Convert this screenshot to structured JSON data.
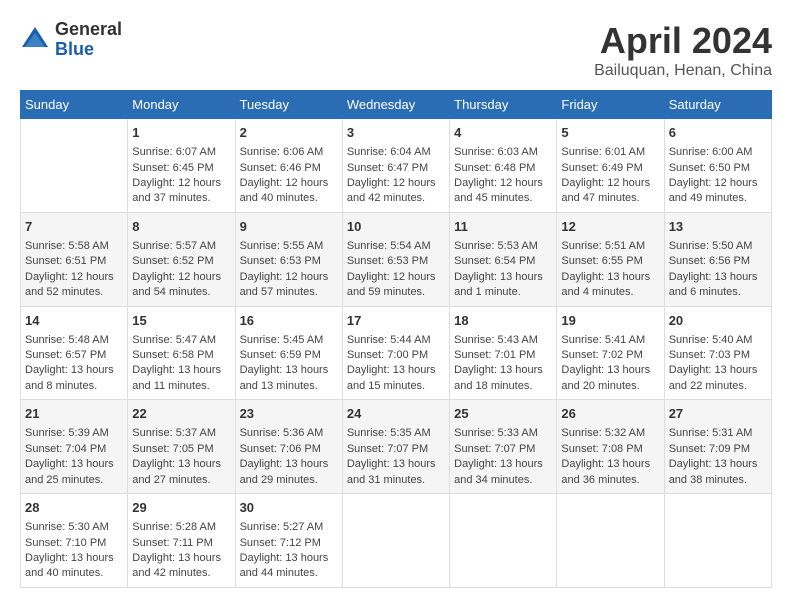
{
  "logo": {
    "general": "General",
    "blue": "Blue"
  },
  "title": "April 2024",
  "subtitle": "Bailuquan, Henan, China",
  "weekdays": [
    "Sunday",
    "Monday",
    "Tuesday",
    "Wednesday",
    "Thursday",
    "Friday",
    "Saturday"
  ],
  "weeks": [
    [
      {
        "day": "",
        "info": ""
      },
      {
        "day": "1",
        "info": "Sunrise: 6:07 AM\nSunset: 6:45 PM\nDaylight: 12 hours\nand 37 minutes."
      },
      {
        "day": "2",
        "info": "Sunrise: 6:06 AM\nSunset: 6:46 PM\nDaylight: 12 hours\nand 40 minutes."
      },
      {
        "day": "3",
        "info": "Sunrise: 6:04 AM\nSunset: 6:47 PM\nDaylight: 12 hours\nand 42 minutes."
      },
      {
        "day": "4",
        "info": "Sunrise: 6:03 AM\nSunset: 6:48 PM\nDaylight: 12 hours\nand 45 minutes."
      },
      {
        "day": "5",
        "info": "Sunrise: 6:01 AM\nSunset: 6:49 PM\nDaylight: 12 hours\nand 47 minutes."
      },
      {
        "day": "6",
        "info": "Sunrise: 6:00 AM\nSunset: 6:50 PM\nDaylight: 12 hours\nand 49 minutes."
      }
    ],
    [
      {
        "day": "7",
        "info": "Sunrise: 5:58 AM\nSunset: 6:51 PM\nDaylight: 12 hours\nand 52 minutes."
      },
      {
        "day": "8",
        "info": "Sunrise: 5:57 AM\nSunset: 6:52 PM\nDaylight: 12 hours\nand 54 minutes."
      },
      {
        "day": "9",
        "info": "Sunrise: 5:55 AM\nSunset: 6:53 PM\nDaylight: 12 hours\nand 57 minutes."
      },
      {
        "day": "10",
        "info": "Sunrise: 5:54 AM\nSunset: 6:53 PM\nDaylight: 12 hours\nand 59 minutes."
      },
      {
        "day": "11",
        "info": "Sunrise: 5:53 AM\nSunset: 6:54 PM\nDaylight: 13 hours\nand 1 minute."
      },
      {
        "day": "12",
        "info": "Sunrise: 5:51 AM\nSunset: 6:55 PM\nDaylight: 13 hours\nand 4 minutes."
      },
      {
        "day": "13",
        "info": "Sunrise: 5:50 AM\nSunset: 6:56 PM\nDaylight: 13 hours\nand 6 minutes."
      }
    ],
    [
      {
        "day": "14",
        "info": "Sunrise: 5:48 AM\nSunset: 6:57 PM\nDaylight: 13 hours\nand 8 minutes."
      },
      {
        "day": "15",
        "info": "Sunrise: 5:47 AM\nSunset: 6:58 PM\nDaylight: 13 hours\nand 11 minutes."
      },
      {
        "day": "16",
        "info": "Sunrise: 5:45 AM\nSunset: 6:59 PM\nDaylight: 13 hours\nand 13 minutes."
      },
      {
        "day": "17",
        "info": "Sunrise: 5:44 AM\nSunset: 7:00 PM\nDaylight: 13 hours\nand 15 minutes."
      },
      {
        "day": "18",
        "info": "Sunrise: 5:43 AM\nSunset: 7:01 PM\nDaylight: 13 hours\nand 18 minutes."
      },
      {
        "day": "19",
        "info": "Sunrise: 5:41 AM\nSunset: 7:02 PM\nDaylight: 13 hours\nand 20 minutes."
      },
      {
        "day": "20",
        "info": "Sunrise: 5:40 AM\nSunset: 7:03 PM\nDaylight: 13 hours\nand 22 minutes."
      }
    ],
    [
      {
        "day": "21",
        "info": "Sunrise: 5:39 AM\nSunset: 7:04 PM\nDaylight: 13 hours\nand 25 minutes."
      },
      {
        "day": "22",
        "info": "Sunrise: 5:37 AM\nSunset: 7:05 PM\nDaylight: 13 hours\nand 27 minutes."
      },
      {
        "day": "23",
        "info": "Sunrise: 5:36 AM\nSunset: 7:06 PM\nDaylight: 13 hours\nand 29 minutes."
      },
      {
        "day": "24",
        "info": "Sunrise: 5:35 AM\nSunset: 7:07 PM\nDaylight: 13 hours\nand 31 minutes."
      },
      {
        "day": "25",
        "info": "Sunrise: 5:33 AM\nSunset: 7:07 PM\nDaylight: 13 hours\nand 34 minutes."
      },
      {
        "day": "26",
        "info": "Sunrise: 5:32 AM\nSunset: 7:08 PM\nDaylight: 13 hours\nand 36 minutes."
      },
      {
        "day": "27",
        "info": "Sunrise: 5:31 AM\nSunset: 7:09 PM\nDaylight: 13 hours\nand 38 minutes."
      }
    ],
    [
      {
        "day": "28",
        "info": "Sunrise: 5:30 AM\nSunset: 7:10 PM\nDaylight: 13 hours\nand 40 minutes."
      },
      {
        "day": "29",
        "info": "Sunrise: 5:28 AM\nSunset: 7:11 PM\nDaylight: 13 hours\nand 42 minutes."
      },
      {
        "day": "30",
        "info": "Sunrise: 5:27 AM\nSunset: 7:12 PM\nDaylight: 13 hours\nand 44 minutes."
      },
      {
        "day": "",
        "info": ""
      },
      {
        "day": "",
        "info": ""
      },
      {
        "day": "",
        "info": ""
      },
      {
        "day": "",
        "info": ""
      }
    ]
  ]
}
